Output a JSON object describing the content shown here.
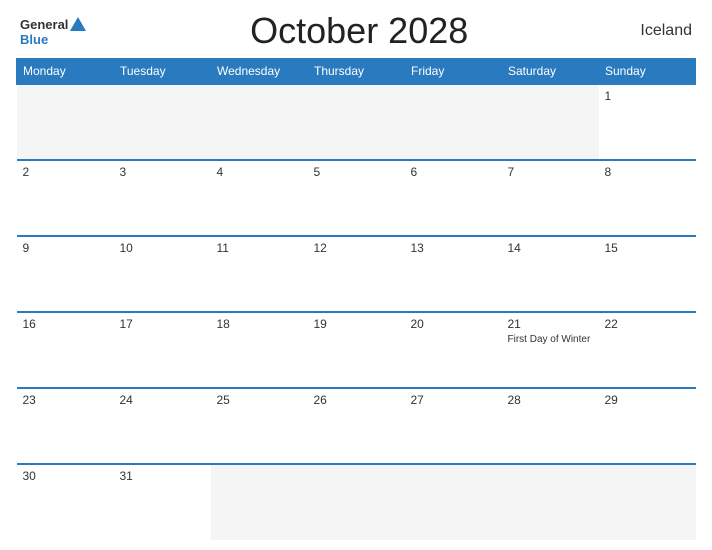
{
  "header": {
    "title": "October 2028",
    "country": "Iceland",
    "logo_general": "General",
    "logo_blue": "Blue"
  },
  "weekdays": [
    "Monday",
    "Tuesday",
    "Wednesday",
    "Thursday",
    "Friday",
    "Saturday",
    "Sunday"
  ],
  "weeks": [
    [
      {
        "day": "",
        "event": "",
        "empty": true
      },
      {
        "day": "",
        "event": "",
        "empty": true
      },
      {
        "day": "",
        "event": "",
        "empty": true
      },
      {
        "day": "",
        "event": "",
        "empty": true
      },
      {
        "day": "",
        "event": "",
        "empty": true
      },
      {
        "day": "",
        "event": "",
        "empty": true
      },
      {
        "day": "1",
        "event": ""
      }
    ],
    [
      {
        "day": "2",
        "event": ""
      },
      {
        "day": "3",
        "event": ""
      },
      {
        "day": "4",
        "event": ""
      },
      {
        "day": "5",
        "event": ""
      },
      {
        "day": "6",
        "event": ""
      },
      {
        "day": "7",
        "event": ""
      },
      {
        "day": "8",
        "event": ""
      }
    ],
    [
      {
        "day": "9",
        "event": ""
      },
      {
        "day": "10",
        "event": ""
      },
      {
        "day": "11",
        "event": ""
      },
      {
        "day": "12",
        "event": ""
      },
      {
        "day": "13",
        "event": ""
      },
      {
        "day": "14",
        "event": ""
      },
      {
        "day": "15",
        "event": ""
      }
    ],
    [
      {
        "day": "16",
        "event": ""
      },
      {
        "day": "17",
        "event": ""
      },
      {
        "day": "18",
        "event": ""
      },
      {
        "day": "19",
        "event": ""
      },
      {
        "day": "20",
        "event": ""
      },
      {
        "day": "21",
        "event": "First Day of Winter"
      },
      {
        "day": "22",
        "event": ""
      }
    ],
    [
      {
        "day": "23",
        "event": ""
      },
      {
        "day": "24",
        "event": ""
      },
      {
        "day": "25",
        "event": ""
      },
      {
        "day": "26",
        "event": ""
      },
      {
        "day": "27",
        "event": ""
      },
      {
        "day": "28",
        "event": ""
      },
      {
        "day": "29",
        "event": ""
      }
    ],
    [
      {
        "day": "30",
        "event": ""
      },
      {
        "day": "31",
        "event": ""
      },
      {
        "day": "",
        "event": "",
        "empty": true
      },
      {
        "day": "",
        "event": "",
        "empty": true
      },
      {
        "day": "",
        "event": "",
        "empty": true
      },
      {
        "day": "",
        "event": "",
        "empty": true
      },
      {
        "day": "",
        "event": "",
        "empty": true
      }
    ]
  ]
}
